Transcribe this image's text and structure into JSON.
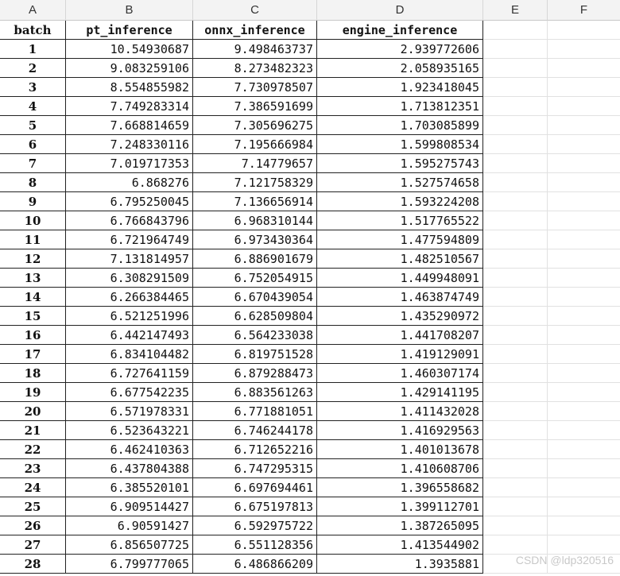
{
  "column_letters": [
    "A",
    "B",
    "C",
    "D",
    "E",
    "F"
  ],
  "header": {
    "batch": "batch",
    "pt": "pt_inference",
    "onnx": "onnx_inference",
    "engine": "engine_inference"
  },
  "rows": [
    [
      "1",
      "10.54930687",
      "9.498463737",
      "2.939772606"
    ],
    [
      "2",
      "9.083259106",
      "8.273482323",
      "2.058935165"
    ],
    [
      "3",
      "8.554855982",
      "7.730978507",
      "1.923418045"
    ],
    [
      "4",
      "7.749283314",
      "7.386591699",
      "1.713812351"
    ],
    [
      "5",
      "7.668814659",
      "7.305696275",
      "1.703085899"
    ],
    [
      "6",
      "7.248330116",
      "7.195666984",
      "1.599808534"
    ],
    [
      "7",
      "7.019717353",
      "7.14779657",
      "1.595275743"
    ],
    [
      "8",
      "6.868276",
      "7.121758329",
      "1.527574658"
    ],
    [
      "9",
      "6.795250045",
      "7.136656914",
      "1.593224208"
    ],
    [
      "10",
      "6.766843796",
      "6.968310144",
      "1.517765522"
    ],
    [
      "11",
      "6.721964749",
      "6.973430364",
      "1.477594809"
    ],
    [
      "12",
      "7.131814957",
      "6.886901679",
      "1.482510567"
    ],
    [
      "13",
      "6.308291509",
      "6.752054915",
      "1.449948091"
    ],
    [
      "14",
      "6.266384465",
      "6.670439054",
      "1.463874749"
    ],
    [
      "15",
      "6.521251996",
      "6.628509804",
      "1.435290972"
    ],
    [
      "16",
      "6.442147493",
      "6.564233038",
      "1.441708207"
    ],
    [
      "17",
      "6.834104482",
      "6.819751528",
      "1.419129091"
    ],
    [
      "18",
      "6.727641159",
      "6.879288473",
      "1.460307174"
    ],
    [
      "19",
      "6.677542235",
      "6.883561263",
      "1.429141195"
    ],
    [
      "20",
      "6.571978331",
      "6.771881051",
      "1.411432028"
    ],
    [
      "21",
      "6.523643221",
      "6.746244178",
      "1.416929563"
    ],
    [
      "22",
      "6.462410363",
      "6.712652216",
      "1.401013678"
    ],
    [
      "23",
      "6.437804388",
      "6.747295315",
      "1.410608706"
    ],
    [
      "24",
      "6.385520101",
      "6.697694461",
      "1.396558682"
    ],
    [
      "25",
      "6.909514427",
      "6.675197813",
      "1.399112701"
    ],
    [
      "26",
      "6.90591427",
      "6.592975722",
      "1.387265095"
    ],
    [
      "27",
      "6.856507725",
      "6.551128356",
      "1.413544902"
    ],
    [
      "28",
      "6.799777065",
      "6.486866209",
      "1.3935881"
    ]
  ],
  "watermark": "CSDN @ldp320516"
}
